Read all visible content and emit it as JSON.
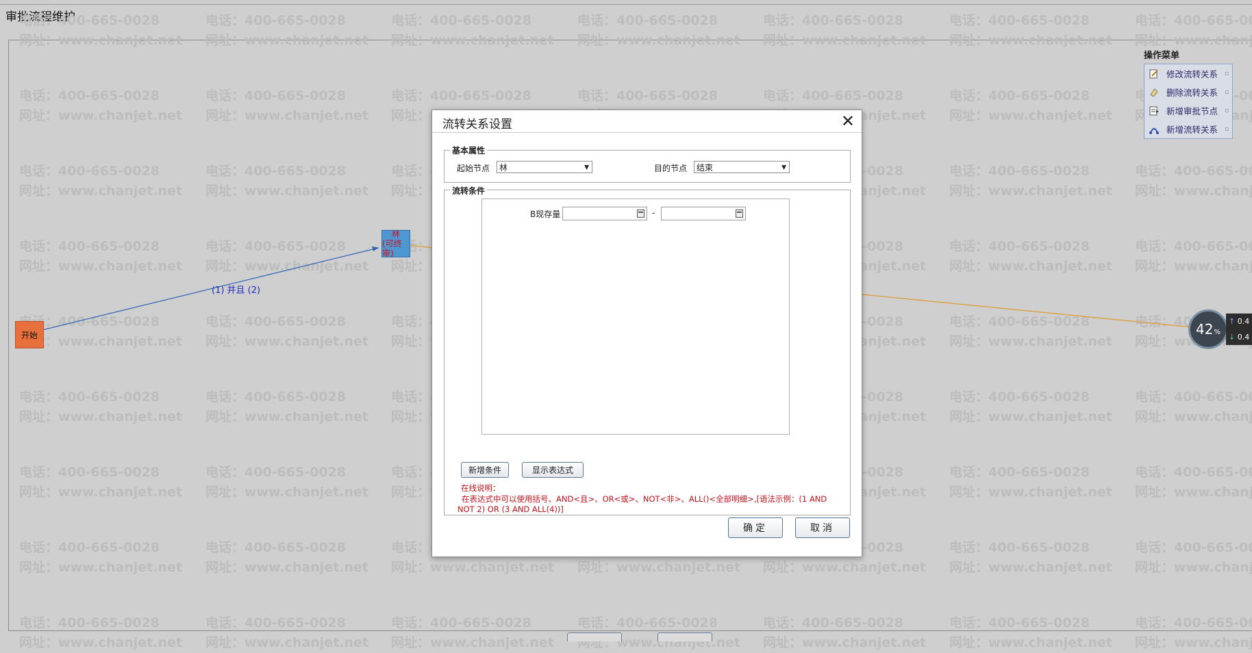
{
  "page": {
    "title": "审批流程维护"
  },
  "watermark": {
    "phone": "电话：400-665-0028",
    "site": "网址：www.chanjet.net"
  },
  "flow": {
    "start_node": "开始",
    "lin_node": {
      "name": "林",
      "sub": "(可终审)"
    },
    "edge_label": "(1) 并且 (2)"
  },
  "op_menu": {
    "title": "操作菜单",
    "items": [
      {
        "label": "修改流转关系",
        "icon": "edit-icon"
      },
      {
        "label": "删除流转关系",
        "icon": "eraser-icon"
      },
      {
        "label": "新增审批节点",
        "icon": "add-node-icon"
      },
      {
        "label": "新增流转关系",
        "icon": "add-relation-icon"
      }
    ]
  },
  "gauge": {
    "value": "42",
    "unit": "%",
    "up": "0.4",
    "down": "0.4"
  },
  "dialog": {
    "title": "流转关系设置",
    "basic": {
      "legend": "基本属性",
      "start_label": "起始节点",
      "start_value": "林",
      "target_label": "目的节点",
      "target_value": "结束"
    },
    "condition": {
      "legend": "流转条件",
      "field_label": "B现存量",
      "range_sep": "-",
      "from_value": "",
      "to_value": ""
    },
    "buttons": {
      "add_condition": "新增条件",
      "show_expression": "显示表达式",
      "ok": "确定",
      "cancel": "取消"
    },
    "note": {
      "title": "在线说明：",
      "text": "在表达式中可以使用括号、AND<且>、OR<或>、NOT<非>、ALL()<全部明细>,[语法示例：(1 AND NOT 2) OR (3 AND ALL(4))]"
    }
  },
  "colors": {
    "start_node": "#e8703c",
    "lin_node": "#4f97d3",
    "edge_blue": "#2f63b5",
    "edge_orange": "#e09a2c",
    "note_red": "#c0101a"
  }
}
